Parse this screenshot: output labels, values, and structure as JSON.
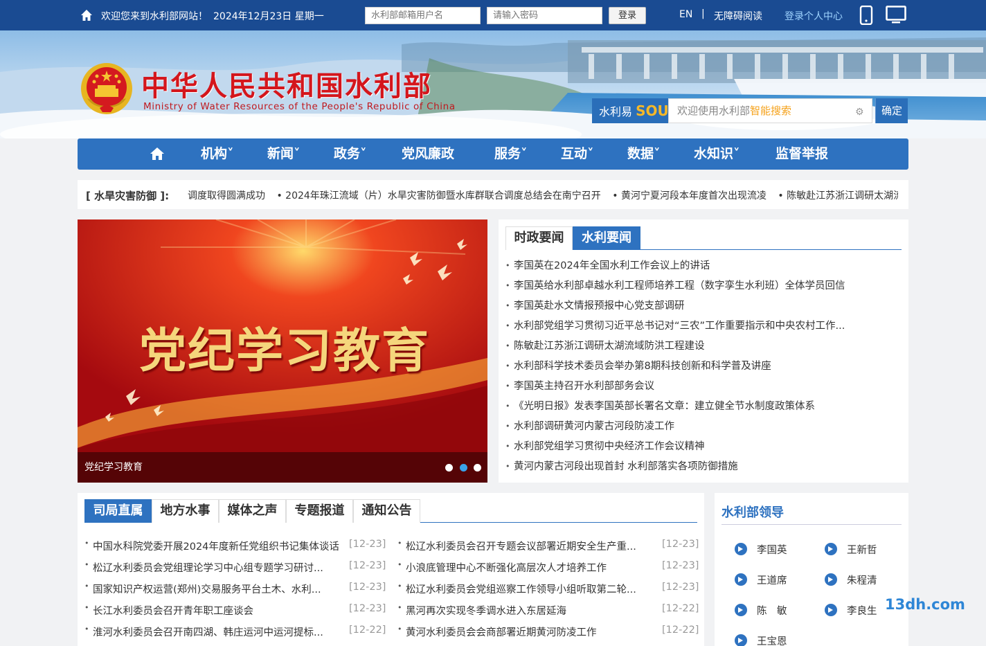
{
  "topbar": {
    "welcome": "欢迎您来到水利部网站！",
    "date": "2024年12月23日 星期一",
    "username_placeholder": "水利部邮箱用户名",
    "password_placeholder": "请输入密码",
    "login_label": "登录",
    "lang": "EN",
    "separator": "|",
    "accessibility": "无障碍阅读",
    "personal_center": "登录个人中心"
  },
  "header": {
    "title": "中华人民共和国水利部",
    "subtitle": "Ministry of Water Resources of the People's Republic of China"
  },
  "search": {
    "brand_prefix": "水利易",
    "brand_suffix": "SOU",
    "placeholder_main": "欢迎使用水利部",
    "placeholder_highlight": "智能搜索",
    "submit": "确定"
  },
  "nav": {
    "items": [
      "机构˅",
      "新闻˅",
      "政务˅",
      "党风廉政",
      "服务˅",
      "互动˅",
      "数据˅",
      "水知识˅",
      "监督举报"
    ]
  },
  "ticker": {
    "label": "[ 水旱灾害防御 ]:",
    "items": [
      "调度取得圆满成功",
      "• 2024年珠江流域（片）水旱灾害防御暨水库群联合调度总结会在南宁召开",
      "• 黄河宁夏河段本年度首次出现流凌",
      "• 陈敏赴江苏浙江调研太湖流域防洪工程建设"
    ]
  },
  "slider": {
    "headline": "党纪学习教育",
    "caption": "党纪学习教育",
    "active_dot": 2
  },
  "news": {
    "tabs": [
      "时政要闻",
      "水利要闻"
    ],
    "active_tab": 1,
    "items": [
      "李国英在2024年全国水利工作会议上的讲话",
      "李国英给水利部卓越水利工程师培养工程（数字孪生水利班）全体学员回信",
      "李国英赴水文情报预报中心党支部调研",
      "水利部党组学习贯彻习近平总书记对“三农”工作重要指示和中央农村工作...",
      "陈敏赴江苏浙江调研太湖流域防洪工程建设",
      "水利部科学技术委员会举办第8期科技创新和科学普及讲座",
      "李国英主持召开水利部部务会议",
      "《光明日报》发表李国英部长署名文章：建立健全节水制度政策体系",
      "水利部调研黄河内蒙古河段防凌工作",
      "水利部党组学习贯彻中央经济工作会议精神",
      "黄河内蒙古河段出现首封 水利部落实各项防御措施"
    ]
  },
  "bottom": {
    "tabs": [
      "司局直属",
      "地方水事",
      "媒体之声",
      "专题报道",
      "通知公告"
    ],
    "active_tab": 0,
    "left": [
      {
        "title": "中国水科院党委开展2024年度新任党组织书记集体谈话",
        "date": "[12-23]"
      },
      {
        "title": "松辽水利委员会党组理论学习中心组专题学习研讨...",
        "date": "[12-23]"
      },
      {
        "title": "国家知识产权运营(郑州)交易服务平台土木、水利...",
        "date": "[12-23]"
      },
      {
        "title": "长江水利委员会召开青年职工座谈会",
        "date": "[12-23]"
      },
      {
        "title": "淮河水利委员会召开南四湖、韩庄运河中运河提标...",
        "date": "[12-22]"
      }
    ],
    "right": [
      {
        "title": "松辽水利委员会召开专题会议部署近期安全生产重...",
        "date": "[12-23]"
      },
      {
        "title": "小浪底管理中心不断强化高层次人才培养工作",
        "date": "[12-23]"
      },
      {
        "title": "松辽水利委员会党组巡察工作领导小组听取第二轮...",
        "date": "[12-23]"
      },
      {
        "title": "黑河再次实现冬季调水进入东居延海",
        "date": "[12-22]"
      },
      {
        "title": "黄河水利委员会会商部署近期黄河防凌工作",
        "date": "[12-22]"
      }
    ]
  },
  "leaders": {
    "title": "水利部领导",
    "names": [
      "李国英",
      "王新哲",
      "王道席",
      "朱程清",
      "陈　敏",
      "李良生",
      "王宝恩"
    ]
  },
  "watermark": "13dh.com",
  "colors": {
    "topbar": "#1a4b92",
    "nav": "#2e72c0",
    "accent": "#d4161c"
  }
}
